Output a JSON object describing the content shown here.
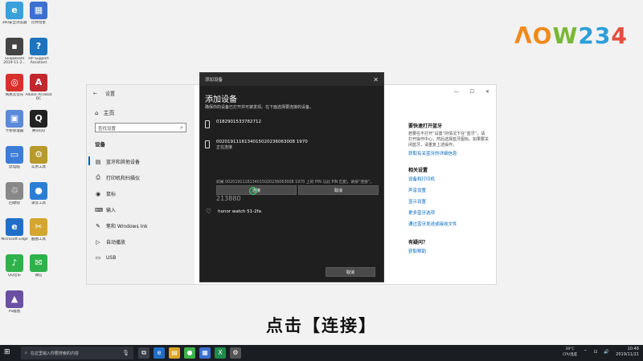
{
  "desktop_icons": [
    {
      "label": "360安全浏览器",
      "glyph": "e",
      "color": "#3aa0dc"
    },
    {
      "label": "比特彗星",
      "glyph": "▦",
      "color": "#3b6fd1"
    },
    {
      "label": "SnapBeam 2019-11-2...",
      "glyph": "▪",
      "color": "#444"
    },
    {
      "label": "HP Support Assistant",
      "glyph": "?",
      "color": "#1e73be"
    },
    {
      "label": "网易云音乐",
      "glyph": "◎",
      "color": "#d8312b"
    },
    {
      "label": "Adobe Acrobat DC",
      "glyph": "A",
      "color": "#c1272d"
    },
    {
      "label": "卡移管理器",
      "glyph": "▣",
      "color": "#5b8ad8"
    },
    {
      "label": "腾讯QQ",
      "glyph": "Q",
      "color": "#222"
    },
    {
      "label": "此电脑",
      "glyph": "▭",
      "color": "#3b7dd8"
    },
    {
      "label": "实用工具",
      "glyph": "⚙",
      "color": "#b79a2a"
    },
    {
      "label": "回收站",
      "glyph": "♲",
      "color": "#888"
    },
    {
      "label": "录音工具",
      "glyph": "●",
      "color": "#2a7fd4"
    },
    {
      "label": "Microsoft Edge",
      "glyph": "e",
      "color": "#1f6fc9"
    },
    {
      "label": "截图工具",
      "glyph": "✂",
      "color": "#d4a630"
    },
    {
      "label": "QQ音乐",
      "glyph": "♪",
      "color": "#2fb24a"
    },
    {
      "label": "微信",
      "glyph": "✉",
      "color": "#2fb24a"
    },
    {
      "label": "PS截图",
      "glyph": "▲",
      "color": "#6a4fa3"
    }
  ],
  "logo": {
    "p1": "ΛO",
    "p2": "W",
    "p3": "23",
    "p4": "4"
  },
  "settings": {
    "title": "设置",
    "back_glyph": "←",
    "home_label": "主页",
    "search_placeholder": "查找设置",
    "section_label": "设备",
    "nav_items": [
      {
        "label": "蓝牙和其他设备",
        "glyph": "▤"
      },
      {
        "label": "打印机和扫描仪",
        "glyph": "⎙"
      },
      {
        "label": "鼠标",
        "glyph": "◉"
      },
      {
        "label": "输入",
        "glyph": "⌨"
      },
      {
        "label": "笔和 Windows Ink",
        "glyph": "✎"
      },
      {
        "label": "自动播放",
        "glyph": "▷"
      },
      {
        "label": "USB",
        "glyph": "▭"
      }
    ],
    "window_controls": {
      "min": "—",
      "max": "☐",
      "close": "✕"
    },
    "right_panel": {
      "title1": "要快速打开蓝牙",
      "text1": "若要在不打开“设置”的情况下在“蓝牙”，请打开操作中心，然后选择蓝牙图标。如果要关闭蓝牙，请重复上述操作。",
      "link1": "获取有关蓝牙的详细信息",
      "title2": "相关设置",
      "links2": [
        "设备和打印机",
        "声音设置",
        "显示设置",
        "更多蓝牙选项",
        "通过蓝牙发送或接收文件"
      ],
      "title3": "有疑问？",
      "link3": "获取帮助"
    }
  },
  "dialog": {
    "title": "添加设备",
    "close_glyph": "✕",
    "heading": "添加设备",
    "subtitle": "确保你的设备已打开并可被发现。在下面选择要连接的设备。",
    "device1": {
      "name": "0182901533782712"
    },
    "device2": {
      "name": "0020191116134015020236063008 1970",
      "status": "正在连接"
    },
    "pin_message": "如果 0020191116134015020236063008 1970 上的 PIN 与此 PIN 匹配，请按“连接”。",
    "pin": "213880",
    "connect_label": "连接",
    "cancel_inline_label": "取消",
    "watch_name": "honor watch 51-2fa",
    "cancel_label": "取消"
  },
  "subtitle": "点击【连接】",
  "taskbar": {
    "start_glyph": "⊞",
    "search_placeholder": "在这里输入你要搜索的内容",
    "apps": [
      {
        "glyph": "⧉",
        "color": "#3a3f46"
      },
      {
        "glyph": "e",
        "color": "#1f6fc9"
      },
      {
        "glyph": "▤",
        "color": "#d9a520"
      },
      {
        "glyph": "●",
        "color": "#3fb24a"
      },
      {
        "glyph": "▦",
        "color": "#3b6fd1"
      },
      {
        "glyph": "X",
        "color": "#1f8a4c"
      },
      {
        "glyph": "⚙",
        "color": "#555"
      }
    ],
    "temp": "39°C",
    "temp_label": "CPU温度",
    "time": "10:48",
    "date": "2019/11/21"
  }
}
